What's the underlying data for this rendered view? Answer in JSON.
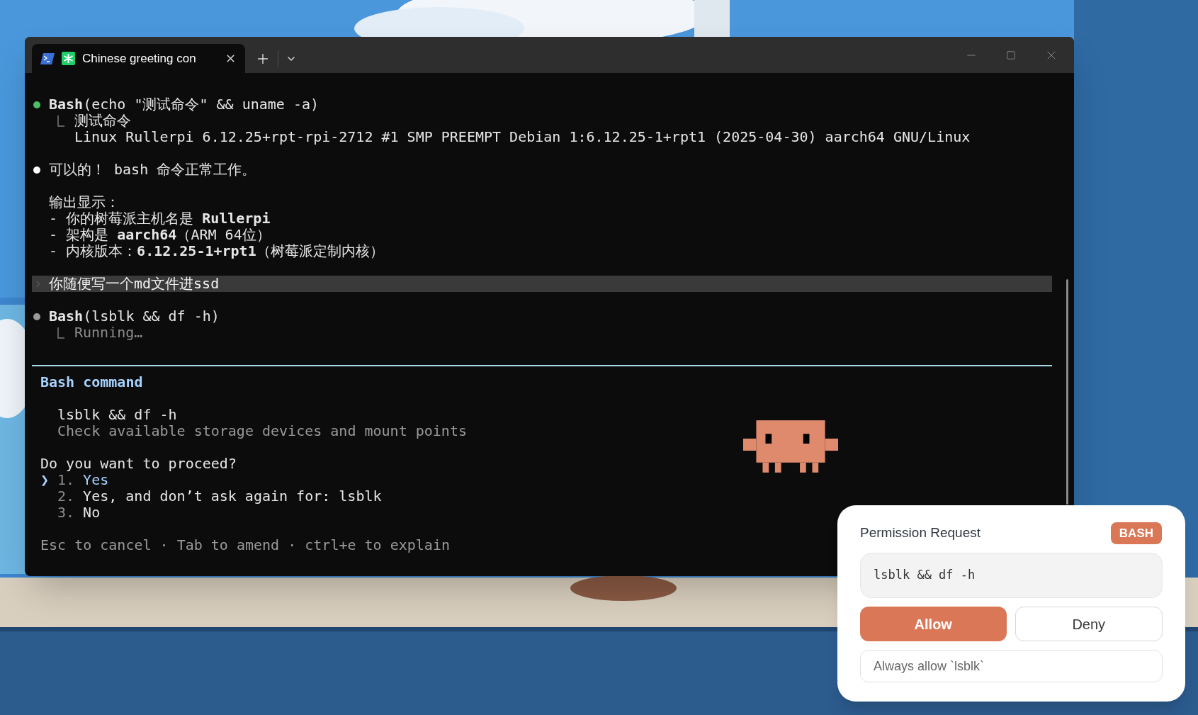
{
  "window": {
    "tabs": [
      {
        "title": "Chinese greeting con",
        "selected": true
      }
    ]
  },
  "transcript": [
    {
      "kind": "tool",
      "color": "#4fbf67",
      "pending": false,
      "call": "**Bash**(echo \"测试命令\" && uname -a)",
      "output": [
        "测试命令",
        "Linux Rullerpi 6.12.25+rpt-rpi-2712 #1 SMP PREEMPT Debian 1:6.12.25-1+rpt1 (2025-04-30) aarch64 GNU/Linux"
      ]
    },
    {
      "kind": "message",
      "color": "#ffffff",
      "paragraphs": [
        [
          "可以的！ bash 命令正常工作。"
        ],
        [
          "输出显示：",
          "- 你的树莓派主机名是 **Rullerpi**",
          "- 架构是 **aarch64**（ARM 64位）",
          "- 内核版本：**6.12.25-1+rpt1**（树莓派定制内核）"
        ]
      ]
    },
    {
      "kind": "prompt",
      "text": "你随便写一个md文件进ssd"
    },
    {
      "kind": "tool",
      "color": "#9a9a9a",
      "pending": true,
      "call": "**Bash**(lsblk && df -h)",
      "output": [
        "Running…"
      ]
    }
  ],
  "permission_prompt": {
    "title": "Bash command",
    "command": "lsblk && df -h",
    "description": "Check available storage devices and mount points",
    "question": "Do you want to proceed?",
    "pointer": "❯",
    "options": [
      {
        "number": "1.",
        "label": "Yes",
        "selected": true
      },
      {
        "number": "2.",
        "label": "Yes, and don’t ask again for: lsblk",
        "selected": false
      },
      {
        "number": "3.",
        "label": "No",
        "selected": false
      }
    ],
    "hint": "Esc to cancel · Tab to amend · ctrl+e to explain"
  },
  "popup": {
    "title": "Permission Request",
    "badge": "BASH",
    "command": "lsblk && df -h",
    "buttons": [
      {
        "label": "Allow",
        "primary": true
      },
      {
        "label": "Deny",
        "primary": false
      }
    ],
    "always_allow": "Always allow `lsblk`"
  }
}
